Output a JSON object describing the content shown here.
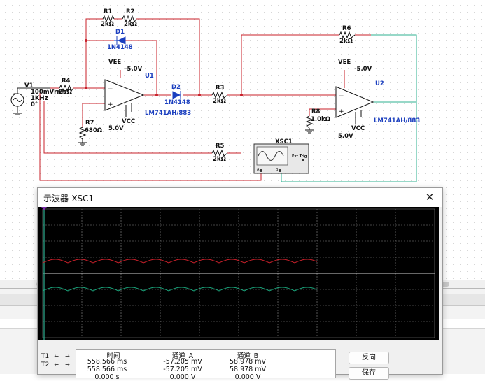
{
  "circuit": {
    "components": [
      {
        "ref": "R1",
        "value": "2kΩ"
      },
      {
        "ref": "R2",
        "value": "2kΩ"
      },
      {
        "ref": "D1",
        "value": "1N4148"
      },
      {
        "ref": "D2",
        "value": "1N4148"
      },
      {
        "ref": "V1",
        "value": "100mVrms",
        "value2": "1KHz",
        "value3": "0°"
      },
      {
        "ref": "R4",
        "value": "2kΩ"
      },
      {
        "ref": "R7",
        "value": "680Ω"
      },
      {
        "ref": "R3",
        "value": "2kΩ"
      },
      {
        "ref": "R5",
        "value": "2kΩ"
      },
      {
        "ref": "R6",
        "value": "2kΩ"
      },
      {
        "ref": "R8",
        "value": "1.0kΩ"
      },
      {
        "ref": "U1",
        "value": "LM741AH/883"
      },
      {
        "ref": "U2",
        "value": "LM741AH/883"
      },
      {
        "ref": "XSC1",
        "value": "Ext Trig"
      }
    ],
    "supplies": {
      "vee": "VEE",
      "vee_value": "-5.0V",
      "vcc": "VCC",
      "vcc_value": "5.0V"
    }
  },
  "oscilloscope": {
    "title": "示波器-XSC1",
    "close_glyph": "✕",
    "screen_bg": "#000000",
    "grid_color": "#8a8a8a",
    "channel_a_color": "#c8202a",
    "channel_b_color": "#1aa37a",
    "cursor_color": "#7a2ea8",
    "t1_label": "T1",
    "t2_label": "T2",
    "left_arrow": "←",
    "right_arrow": "→",
    "columns": [
      "时间",
      "通道_A",
      "通道_B"
    ],
    "rows": [
      [
        "558.566 ms",
        "-57.205 mV",
        "58.978 mV"
      ],
      [
        "558.566 ms",
        "-57.205 mV",
        "58.978 mV"
      ],
      [
        "0.000 s",
        "0.000 V",
        "0.000 V"
      ]
    ],
    "buttons": {
      "reverse": "反向",
      "save": "保存"
    }
  }
}
